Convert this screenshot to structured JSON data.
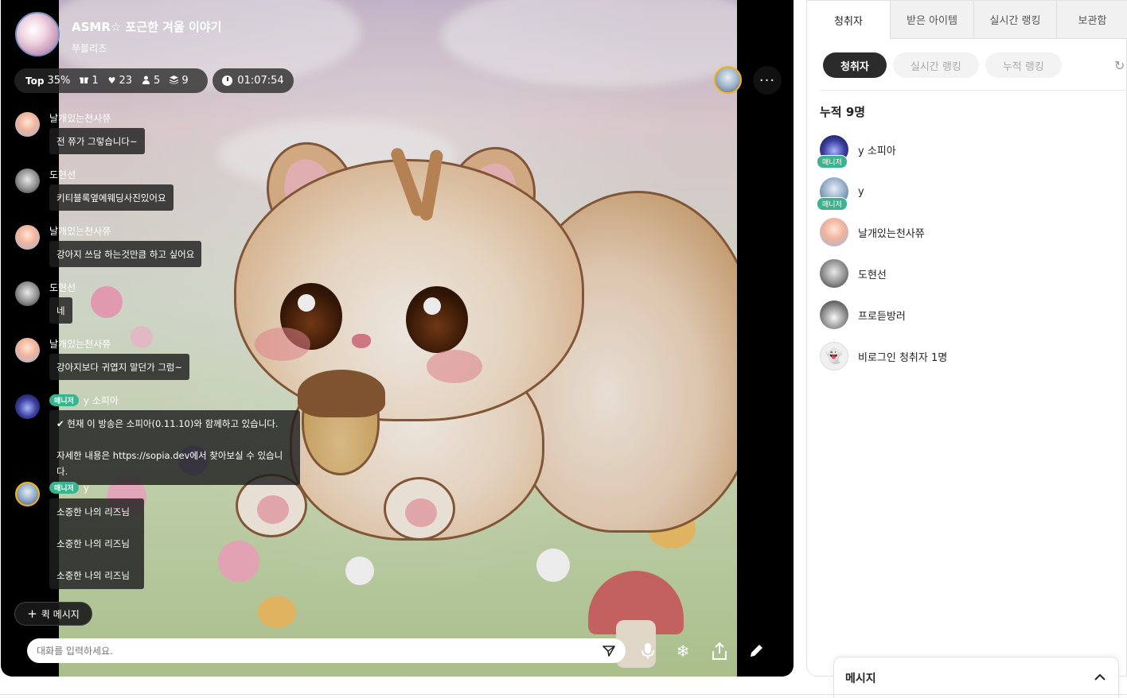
{
  "broadcast": {
    "title": "ASMR☆ 포근한 겨울 이야기",
    "host": "쭈블리즈",
    "stats": {
      "top_label": "Top",
      "top_value": "35%",
      "gifts": "1",
      "likes": "23",
      "listeners": "5",
      "layers": "9"
    },
    "time": "01:07:54",
    "more_label": "···"
  },
  "chat": {
    "messages": [
      {
        "name": "날개있는천사쮸",
        "text": "전 쮸가 그렇습니다~"
      },
      {
        "name": "도현선",
        "text": "키티블록옆에웨딩사진있어요"
      },
      {
        "name": "날개있는천사쮸",
        "text": "강아지 쓰담 하는것만큼 하고 싶어요"
      },
      {
        "name": "도현선",
        "text": "네"
      },
      {
        "name": "날개있는천사쮸",
        "text": "강아지보다 귀엽지 말던가 그럼~"
      },
      {
        "name": "y 소피아",
        "badge": "매니저",
        "lines": [
          "✔ 현재 이 방송은 소피아(0.11.10)와 함께하고 있습니다.",
          "자세한 내용은 https://sopia.dev에서 찾아보실 수 있습니다."
        ]
      },
      {
        "name": "y",
        "badge": "매니저",
        "lines": [
          "소중한 나의 리즈님",
          "소중한 나의 리즈님",
          "소중한 나의 리즈님"
        ]
      }
    ],
    "quick_message": "퀵 메시지",
    "input_placeholder": "대화를 입력하세요."
  },
  "panel": {
    "tabs": [
      "청취자",
      "받은 아이템",
      "실시간 랭킹",
      "보관함"
    ],
    "subtabs": [
      "청취자",
      "실시간 랭킹",
      "누적 랭킹"
    ],
    "total": "누적 9명",
    "listeners": [
      {
        "name": "y 소피아",
        "badge": "매니저"
      },
      {
        "name": "y",
        "badge": "매니저"
      },
      {
        "name": "날개있는천사쮸"
      },
      {
        "name": "도현선"
      },
      {
        "name": "프로듣방러"
      },
      {
        "name": "비로그인 청취자 1명"
      }
    ]
  },
  "message_dock": {
    "title": "메시지"
  },
  "icons": {
    "gift": "gift-icon",
    "heart": "heart-icon",
    "person": "person-icon",
    "layers": "layers-icon",
    "clock": "clock-icon",
    "send": "send-icon",
    "mic": "mic-icon",
    "snow": "snowflake-icon",
    "share": "share-icon",
    "pen": "pen-icon",
    "refresh": "refresh-icon",
    "chevron": "chevron-up-icon"
  },
  "colors": {
    "manager_badge": "#3bb38f",
    "active_subtab": "#2b2b2b",
    "vip_ring": "#f0b419"
  }
}
